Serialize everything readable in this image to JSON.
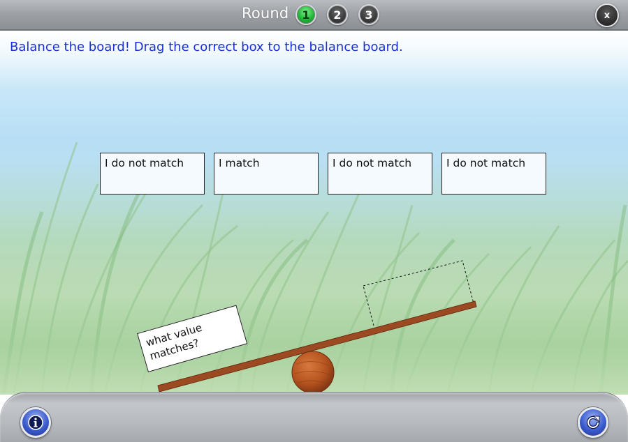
{
  "header": {
    "round_label": "Round",
    "rounds": [
      {
        "label": "1",
        "state": "current"
      },
      {
        "label": "2",
        "state": "locked"
      },
      {
        "label": "3",
        "state": "locked"
      }
    ],
    "close_label": "x"
  },
  "instruction": "Balance the board! Drag the correct box to the balance board.",
  "answer_boxes": [
    "I do not match",
    "I match",
    "I do not match",
    "I do not match"
  ],
  "question_box": {
    "line1": "what value",
    "line2": "matches?"
  },
  "footer": {
    "info_icon": "info-icon",
    "reload_icon": "reload-icon"
  },
  "colors": {
    "instruction_text": "#1a2fd6",
    "active_round": "#1fb536",
    "board_wood": "#9b4a22",
    "round_button_blue": "#3b5ccf"
  }
}
